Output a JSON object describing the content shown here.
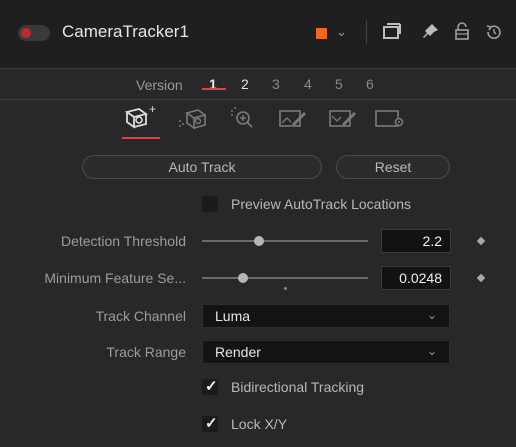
{
  "header": {
    "tool_name": "CameraTracker1",
    "swatch_color": "#f06a15"
  },
  "version": {
    "label": "Version",
    "numbers": [
      "1",
      "2",
      "3",
      "4",
      "5",
      "6"
    ],
    "active": "1"
  },
  "tabs": [
    {
      "icon": "camera-track-icon",
      "active": true
    },
    {
      "icon": "camera-solve-icon",
      "active": false
    },
    {
      "icon": "zoom-target-icon",
      "active": false
    },
    {
      "icon": "export-image-icon",
      "active": false
    },
    {
      "icon": "export-image-alt-icon",
      "active": false
    },
    {
      "icon": "settings-gear-icon",
      "active": false
    }
  ],
  "buttons": {
    "auto_track": "Auto Track",
    "reset": "Reset"
  },
  "preview_autotrack": {
    "label": "Preview AutoTrack Locations",
    "checked": false
  },
  "detection_threshold": {
    "label": "Detection Threshold",
    "value": "2.2"
  },
  "min_feature": {
    "label": "Minimum Feature Se...",
    "value": "0.0248"
  },
  "track_channel": {
    "label": "Track Channel",
    "value": "Luma"
  },
  "track_range": {
    "label": "Track Range",
    "value": "Render"
  },
  "bidirectional": {
    "label": "Bidirectional Tracking",
    "checked": true
  },
  "lock_xy": {
    "label": "Lock X/Y",
    "checked": true
  },
  "colors": {
    "accent_red": "#e0423f",
    "power_red": "#e8323a"
  }
}
